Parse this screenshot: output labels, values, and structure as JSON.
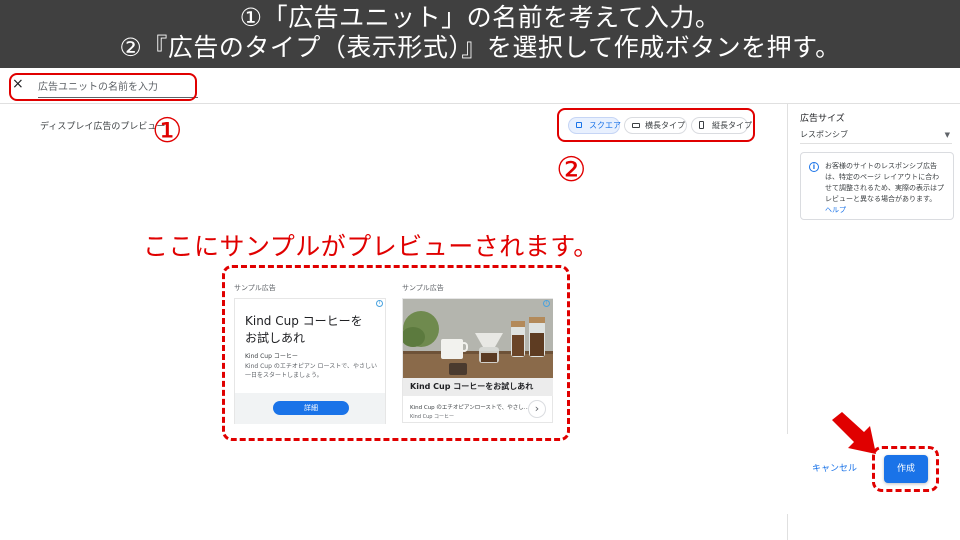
{
  "banner": {
    "line1": "①「広告ユニット」の名前を考えて入力。",
    "line2": "②『広告のタイプ（表示形式）』を選択して作成ボタンを押す。"
  },
  "topbar": {
    "close_label": "×",
    "name_placeholder": "広告ユニットの名前を入力"
  },
  "preview": {
    "label": "ディスプレイ広告のプレビュー"
  },
  "ad_types": [
    {
      "label": "スクエア",
      "selected": true
    },
    {
      "label": "横長タイプ",
      "selected": false
    },
    {
      "label": "縦長タイプ",
      "selected": false
    }
  ],
  "sidebar": {
    "size_title": "広告サイズ",
    "size_value": "レスポンシブ",
    "info_icon": "info-icon",
    "info_text": "お客様のサイトのレスポンシブ広告は、特定のページ レイアウトに合わせて調整されるため、実際の表示はプレビューと異なる場合があります。",
    "help_link": "ヘルプ"
  },
  "annotations": {
    "num1": "①",
    "num2": "②",
    "caption": "ここにサンプルがプレビューされます。",
    "color": "#e00000"
  },
  "sample_ads": {
    "ad1": {
      "label": "サンプル広告",
      "headline": "Kind Cup コーヒーを お試しあれ",
      "brand": "Kind Cup コーヒー",
      "description": "Kind Cup のエチオピアン ローストで、やさしい一日をスタートしましょう。",
      "button": "詳細"
    },
    "ad2": {
      "label": "サンプル広告",
      "headline": "Kind Cup コーヒーをお試しあれ",
      "description": "Kind Cup のエチオピアンローストで、やさし...",
      "brand": "Kind Cup コーヒー",
      "next_label": "›"
    }
  },
  "actions": {
    "cancel": "キャンセル",
    "create": "作成"
  },
  "colors": {
    "accent": "#1a73e8",
    "banner_bg": "#404040",
    "annotation_red": "#e00000"
  }
}
